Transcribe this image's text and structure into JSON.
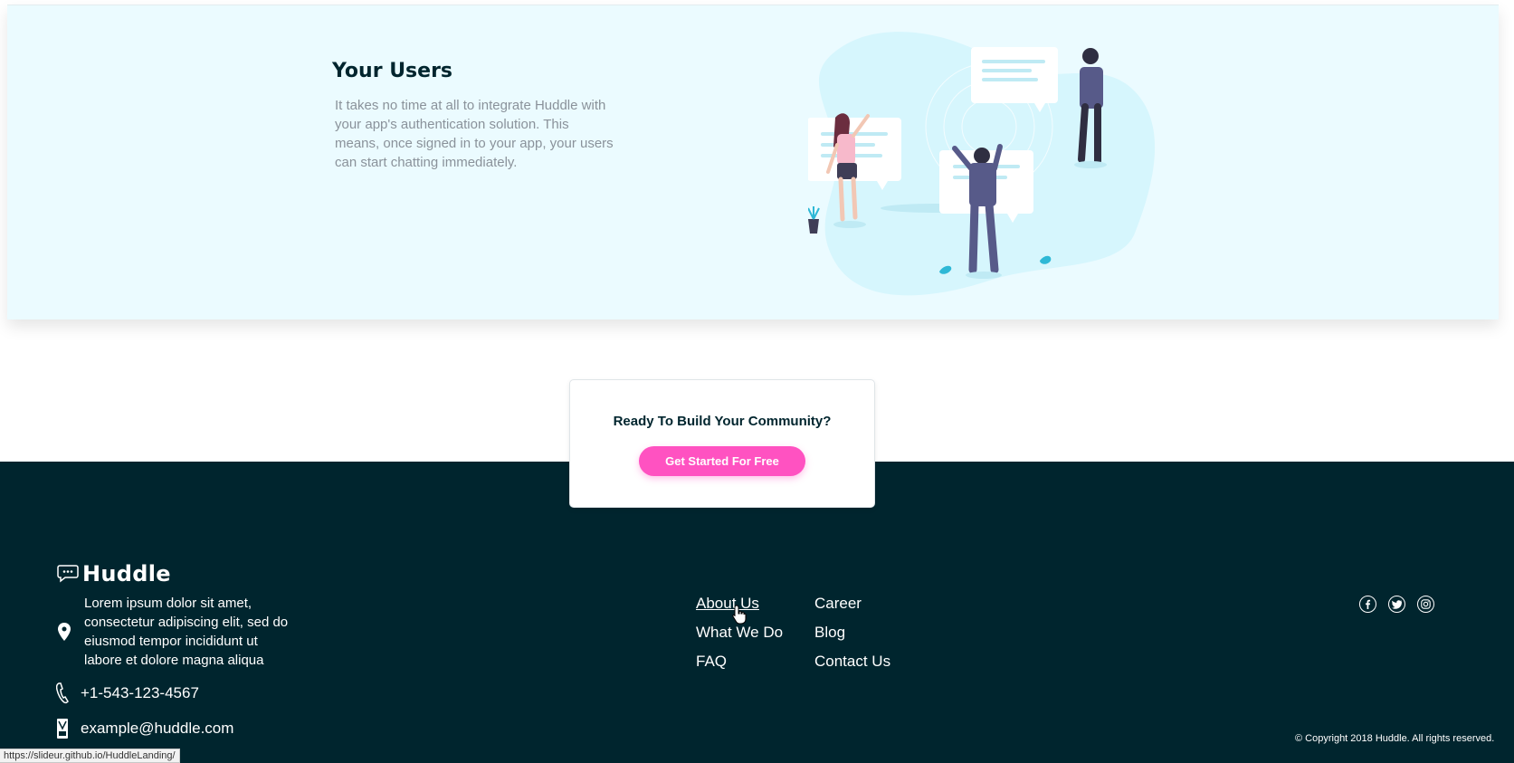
{
  "feature": {
    "title": "Your Users",
    "description": "It takes no time at all to integrate Huddle with your app's authentication solution. This means, once signed in to your app, your users can start chatting immediately.",
    "illustration_icon": "people-chatting-illustration"
  },
  "cta": {
    "title": "Ready To Build Your Community?",
    "button_label": "Get Started For Free"
  },
  "footer": {
    "brand": {
      "name": "Huddle",
      "icon": "chat-bubble-icon"
    },
    "address": "Lorem ipsum dolor sit amet, consectetur adipiscing elit, sed do eiusmod tempor incididunt ut labore et dolore magna aliqua",
    "phone": "+1-543-123-4567",
    "email": "example@huddle.com",
    "links": {
      "about": "About Us",
      "what_we_do": "What We Do",
      "faq": "FAQ",
      "career": "Career",
      "blog": "Blog",
      "contact": "Contact Us"
    },
    "social": [
      "facebook-icon",
      "twitter-icon",
      "instagram-icon"
    ],
    "copyright": "© Copyright 2018 Huddle. All rights reserved."
  },
  "status_bar": {
    "url": "https://slideur.github.io/HuddleLanding/"
  },
  "colors": {
    "feature_bg": "#ebfbff",
    "footer_bg": "#00252e",
    "accent_pink": "#ff52c1",
    "muted_text": "#8a929a"
  }
}
